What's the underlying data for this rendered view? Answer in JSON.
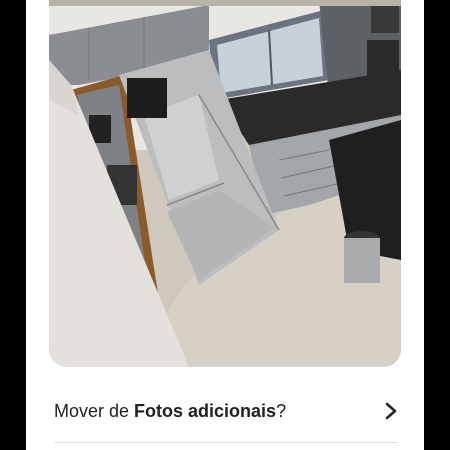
{
  "photo": {
    "subject": "kitchen photo",
    "icon": "photo-image"
  },
  "move_option": {
    "prefix": "Mover de ",
    "album": "Fotos adicionais",
    "suffix": "?",
    "chevron_icon": "chevron-right-icon"
  },
  "colors": {
    "background": "#000000",
    "sheet": "#ffffff",
    "text": "#222222",
    "divider": "#dddddd"
  }
}
